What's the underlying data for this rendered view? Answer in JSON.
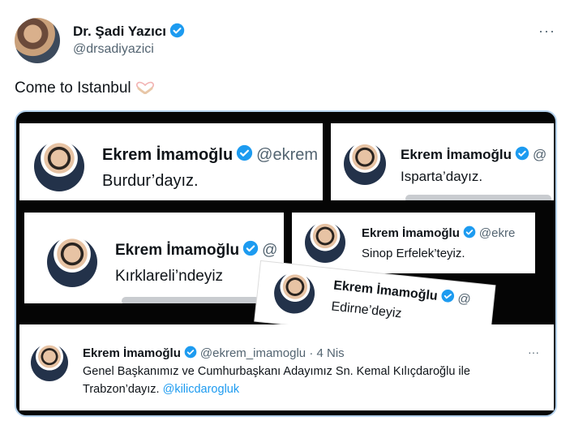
{
  "tweet": {
    "author_name": "Dr. Şadi Yazıcı",
    "author_handle": "@drsadiyazici",
    "text": "Come to Istanbul",
    "more": "···"
  },
  "cards": {
    "burdur": {
      "name": "Ekrem İmamoğlu",
      "handle": "@ekrem",
      "text": "Burdur’dayız."
    },
    "isparta": {
      "name": "Ekrem İmamoğlu",
      "handle": "@",
      "text": "Isparta’dayız."
    },
    "kirklareli": {
      "name": "Ekrem İmamoğlu",
      "handle": "@",
      "text": "Kırklareli’ndeyiz"
    },
    "sinop": {
      "name": "Ekrem İmamoğlu",
      "handle": "@ekre",
      "text": "Sinop Erfelek’teyiz."
    },
    "edirne": {
      "name": "Ekrem İmamoğlu",
      "handle": "@",
      "text": "Edirne’deyiz"
    },
    "trabzon": {
      "name": "Ekrem İmamoğlu",
      "handle": "@ekrem_imamoglu",
      "date": "· 4 Nis",
      "more": "···",
      "text_line1": "Genel Başkanımız ve Cumhurbaşkanı Adayımız Sn. Kemal Kılıçdaroğlu ile",
      "text_line2": "Trabzon’dayız.",
      "mention": "@kilicdarogluk"
    }
  },
  "colors": {
    "verified": "#1d9bf0",
    "text": "#0f1419",
    "secondary": "#536471",
    "collage_border": "#b6d3ee"
  }
}
